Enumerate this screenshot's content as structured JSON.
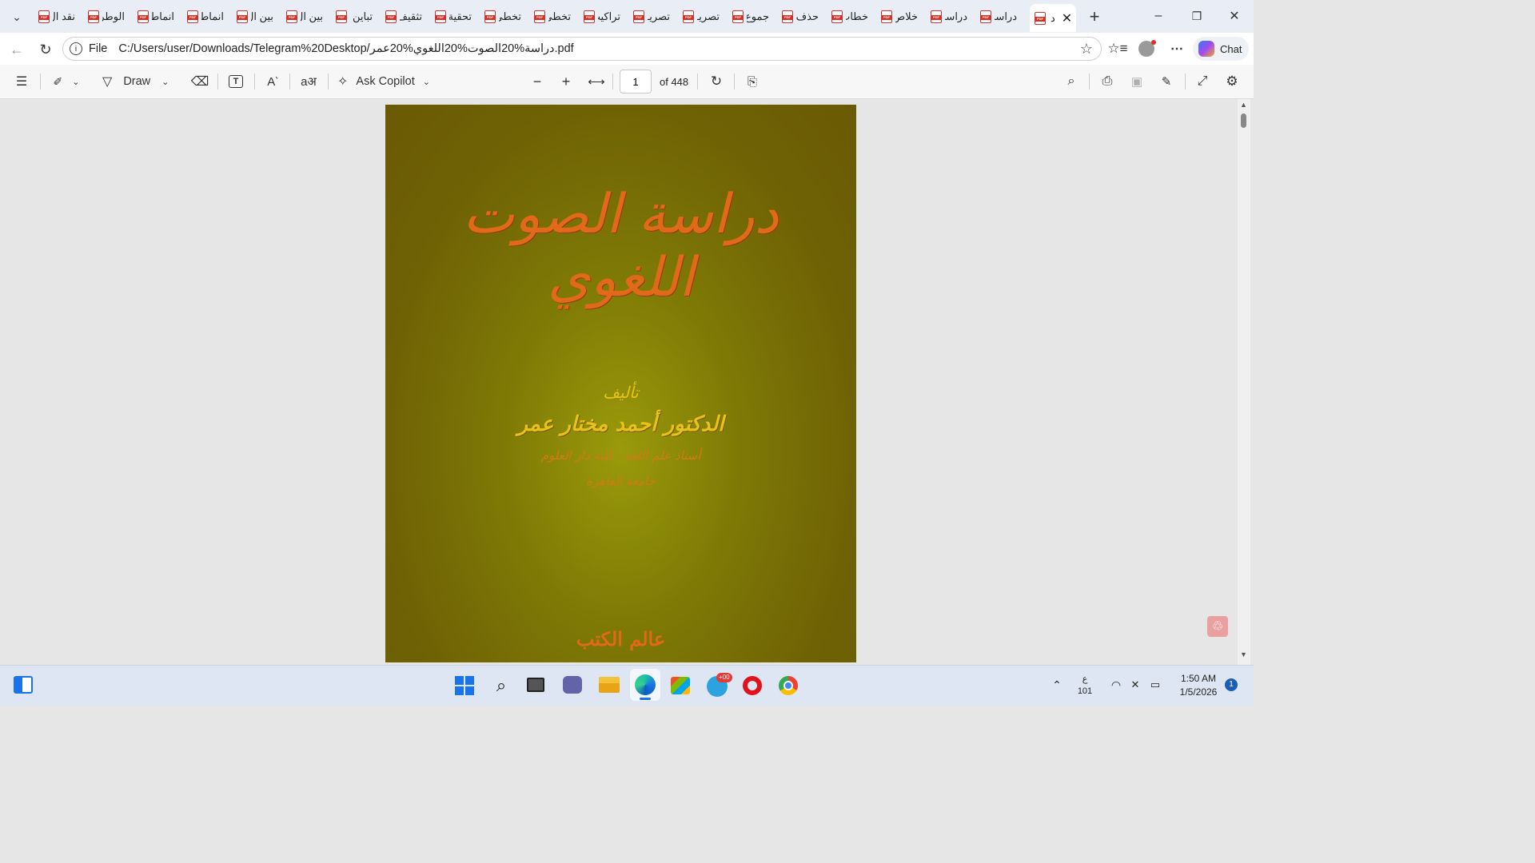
{
  "browser": {
    "tabs": [
      {
        "label": "نقد ال"
      },
      {
        "label": "الوطر"
      },
      {
        "label": "انماط"
      },
      {
        "label": "انماط"
      },
      {
        "label": "بين ال"
      },
      {
        "label": "بين ال"
      },
      {
        "label": "تباين"
      },
      {
        "label": "تثقيف"
      },
      {
        "label": "تحقية"
      },
      {
        "label": "تخطئ"
      },
      {
        "label": "تخطئ"
      },
      {
        "label": "تراكيب"
      },
      {
        "label": "تصريـ"
      },
      {
        "label": "تصريـ"
      },
      {
        "label": "جموع"
      },
      {
        "label": "حذف"
      },
      {
        "label": "خطاب"
      },
      {
        "label": "خلاص"
      },
      {
        "label": "دراسة"
      },
      {
        "label": "دراسة"
      }
    ],
    "active_tab": {
      "label": "د"
    },
    "address": {
      "scheme": "File",
      "url": "C:/Users/user/Downloads/Telegram%20Desktop/دراسة%20الصوت%20اللغوي%20عمر.pdf"
    },
    "chat_label": "Chat"
  },
  "pdf_toolbar": {
    "draw_label": "Draw",
    "copilot_label": "Ask Copilot",
    "page_number": "1",
    "page_total": "of 448"
  },
  "document": {
    "title": "دراسة الصوت اللغوي",
    "by_label": "تأليف",
    "author": "الدكتور أحمد مختار عمر",
    "affiliation_line1": "أستاذ علم اللغة - كلية دار العلوم",
    "affiliation_line2": "جامعة القاهرة",
    "publisher": "عالم الكتب",
    "colors": {
      "background": "#7a7006",
      "title": "#e06a1a",
      "author": "#e8c21a"
    }
  },
  "taskbar": {
    "telegram_badge": "+00",
    "lang_top": "ع",
    "lang_bottom": "101",
    "time": "1:50 AM",
    "date": "1/5/2026",
    "notification_count": "1"
  }
}
